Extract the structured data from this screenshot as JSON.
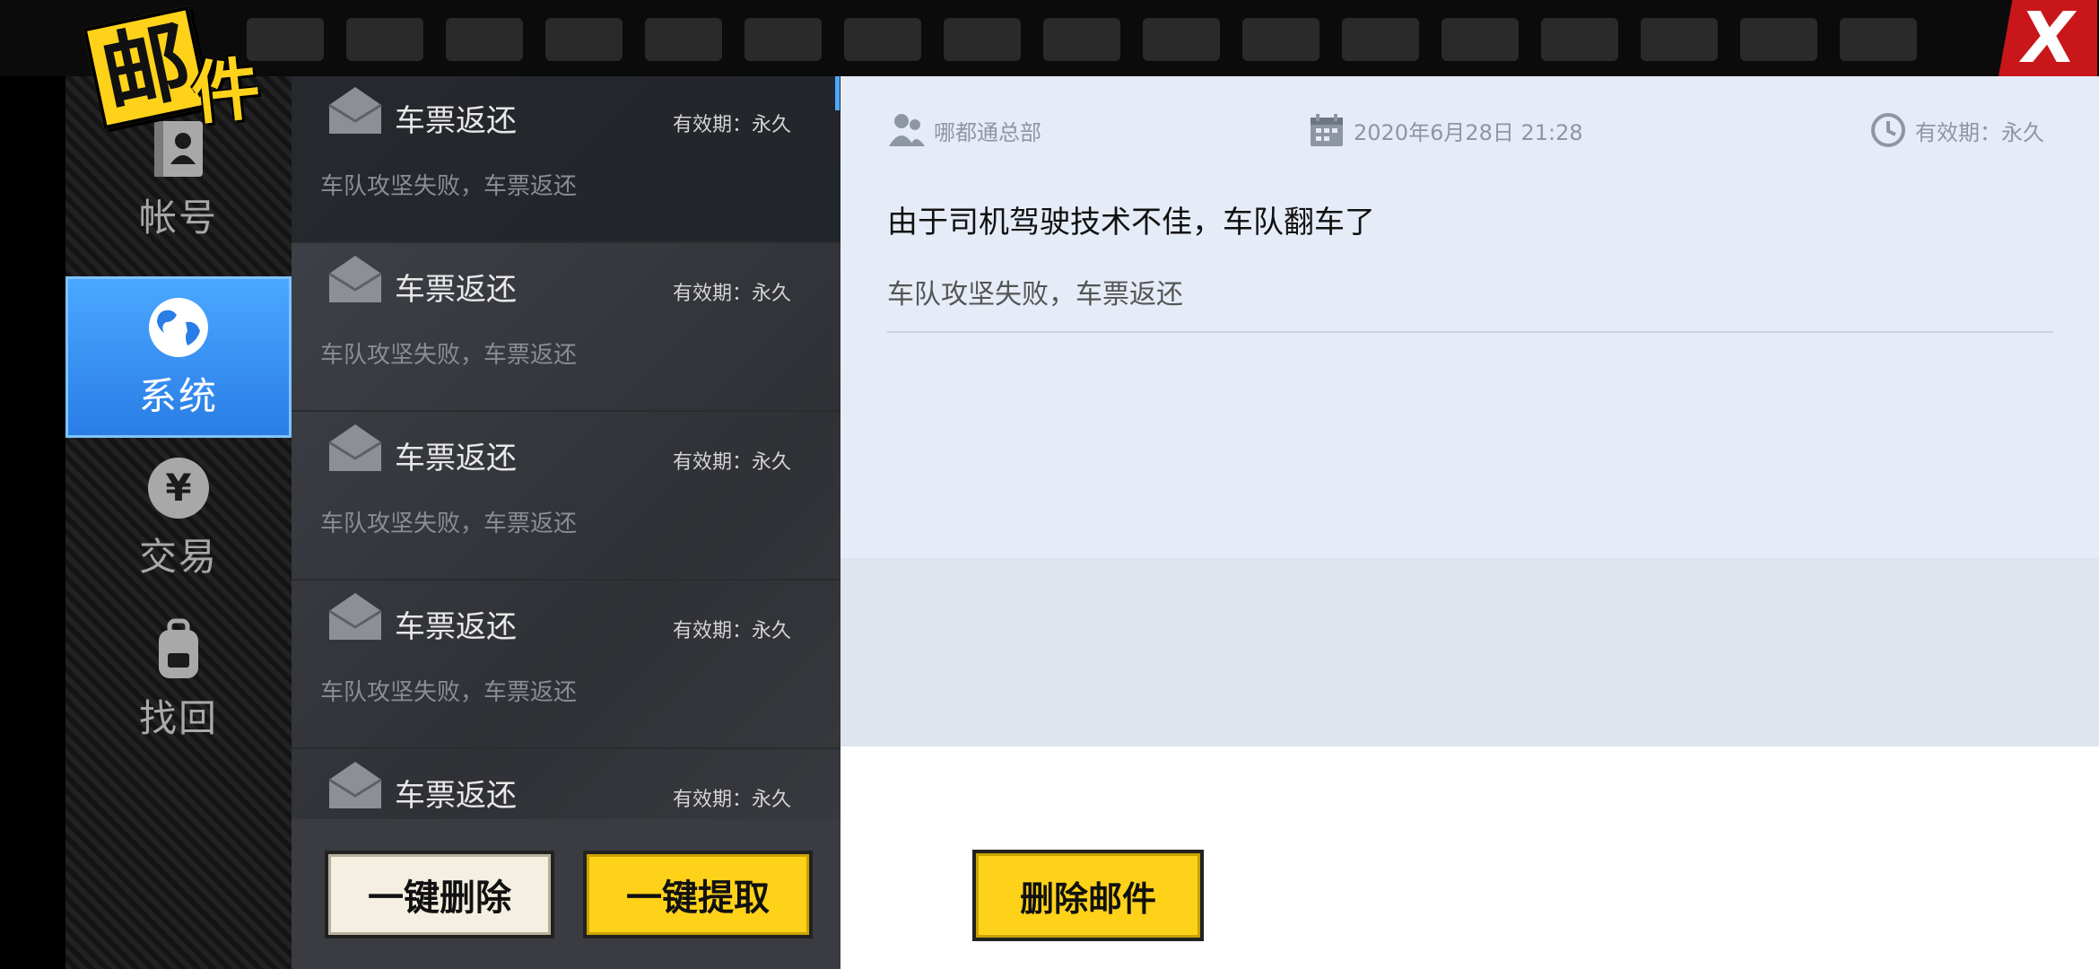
{
  "title": {
    "char1": "邮",
    "char2": "件"
  },
  "close": {
    "label": "X"
  },
  "nav": {
    "items": [
      {
        "label": "帐号",
        "icon": "account-icon"
      },
      {
        "label": "系统",
        "icon": "globe-icon",
        "active": true
      },
      {
        "label": "交易",
        "icon": "yen-icon"
      },
      {
        "label": "找回",
        "icon": "backpack-icon"
      }
    ]
  },
  "mail_list": {
    "items": [
      {
        "title": "车票返还",
        "expiry": "有效期：永久",
        "summary": "车队攻坚失败，车票返还",
        "selected": true
      },
      {
        "title": "车票返还",
        "expiry": "有效期：永久",
        "summary": "车队攻坚失败，车票返还"
      },
      {
        "title": "车票返还",
        "expiry": "有效期：永久",
        "summary": "车队攻坚失败，车票返还"
      },
      {
        "title": "车票返还",
        "expiry": "有效期：永久",
        "summary": "车队攻坚失败，车票返还"
      },
      {
        "title": "车票返还",
        "expiry": "有效期：永久",
        "summary": ""
      }
    ],
    "delete_all_label": "一键删除",
    "claim_all_label": "一键提取"
  },
  "detail": {
    "sender": "哪都通总部",
    "date": "2020年6月28日  21:28",
    "expiry": "有效期：永久",
    "heading": "由于司机驾驶技术不佳，车队翻车了",
    "body": "车队攻坚失败，车票返还",
    "delete_label": "删除邮件"
  },
  "colors": {
    "accent_blue": "#2a7de6",
    "accent_yellow": "#ffd21a",
    "close_red": "#c8161b"
  }
}
